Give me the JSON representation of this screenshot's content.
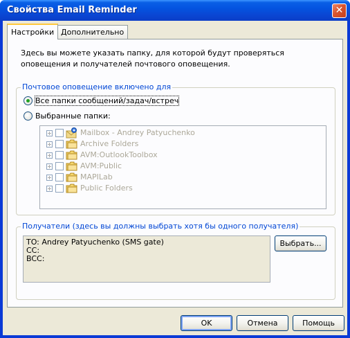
{
  "window": {
    "title": "Свойства Email Reminder"
  },
  "tabs": [
    {
      "label": "Настройки",
      "active": true
    },
    {
      "label": "Дополнительно",
      "active": false
    }
  ],
  "settings": {
    "intro_text": "Здесь вы можете указать папку, для которой будут проверяться оповещения и получателей почтового оповещения.",
    "notification_group": {
      "legend": "Почтовое оповещение включено для",
      "option_all": "Все папки сообщений/задач/встреч",
      "option_selected": "Выбранные папки:",
      "selected_option": "all"
    },
    "folders": [
      {
        "label": "Mailbox - Andrey Patyuchenko",
        "icon": "mailbox-icon"
      },
      {
        "label": "Archive Folders",
        "icon": "folder-icon"
      },
      {
        "label": "AVM:OutlookToolbox",
        "icon": "folder-icon"
      },
      {
        "label": "AVM:Public",
        "icon": "folder-icon"
      },
      {
        "label": "MAPILab",
        "icon": "folder-icon"
      },
      {
        "label": "Public Folders",
        "icon": "folder-icon"
      }
    ],
    "recipients_group": {
      "legend": "Получатели (здесь вы должны выбрать хотя бы одного получателя)",
      "to": "TO: Andrey Patyuchenko (SMS gate)",
      "cc": "CC:",
      "bcc": "BCC:",
      "select_button": "Выбрать..."
    }
  },
  "footer": {
    "ok": "OK",
    "cancel": "Отмена",
    "help": "Помощь"
  },
  "colors": {
    "title_bar": "#0a54e0",
    "group_legend": "#0046d5",
    "disabled_text": "#aca899",
    "dialog_face": "#ece9d8"
  }
}
